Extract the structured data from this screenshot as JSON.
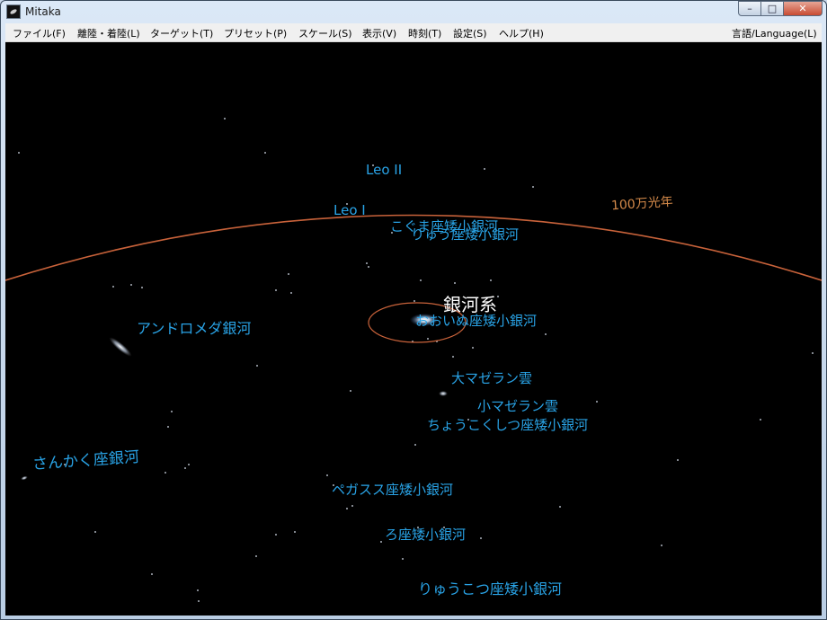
{
  "window": {
    "title": "Mitaka"
  },
  "titlebar_buttons": {
    "minimize": "–",
    "maximize": "□",
    "close": "✕"
  },
  "menu": {
    "file": "ファイル(F)",
    "landing": "離陸・着陸(L)",
    "target": "ターゲット(T)",
    "preset": "プリセット(P)",
    "scale": "スケール(S)",
    "view": "表示(V)",
    "time": "時刻(T)",
    "settings": "設定(S)",
    "help": "ヘルプ(H)",
    "language": "言語/Language(L)"
  },
  "view": {
    "scale_label": "100万光年",
    "milky_way": "銀河系",
    "labels": {
      "leo_ii": "Leo II",
      "leo_i": "Leo I",
      "ursa_minor": "こぐま座矮小銀河",
      "draco": "りゅう座矮小銀河",
      "canes": "おおいぬ座矮小銀河",
      "andromeda": "アンドロメダ銀河",
      "lmc": "大マゼラン雲",
      "smc": "小マゼラン雲",
      "sculptor": "ちょうこくしつ座矮小銀河",
      "triangulum": "さんかく座銀河",
      "pegasus": "ペガスス座矮小銀河",
      "fornax": "ろ座矮小銀河",
      "cetus": "りゅうこつ座矮小銀河"
    },
    "colors": {
      "label": "#29a3e6",
      "scale": "#c8623a",
      "scale_text": "#d48a4a",
      "milky_way_text": "#ffffff"
    }
  }
}
